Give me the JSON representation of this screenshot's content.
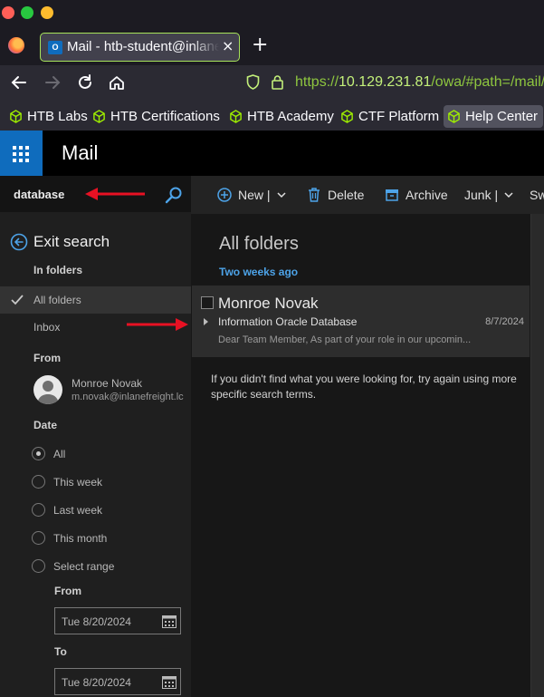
{
  "browser": {
    "tab_title": "Mail - htb-student@inlanefreight.local",
    "tab_close": "×",
    "new_tab": "+",
    "url_scheme": "https://",
    "url_host": "10.129.231.81",
    "url_path": "/owa/#path=/mail/s",
    "bookmarks": [
      "HTB Labs",
      "HTB Certifications",
      "HTB Academy",
      "CTF Platform",
      "Help Center"
    ]
  },
  "owa": {
    "app_title": "Mail",
    "search": {
      "query": "database"
    },
    "exit_search": "Exit search",
    "in_folders_heading": "In folders",
    "folders": [
      "All folders",
      "Inbox"
    ],
    "from_heading": "From",
    "from_person": {
      "name": "Monroe Novak",
      "email": "m.novak@inlanefreight.lc"
    },
    "date_heading": "Date",
    "date_options": [
      "All",
      "This week",
      "Last week",
      "This month",
      "Select range"
    ],
    "date_selected": "All",
    "range_from_label": "From",
    "range_from_value": "Tue 8/20/2024",
    "range_to_label": "To",
    "range_to_value": "Tue 8/20/2024"
  },
  "toolbar": {
    "new_label": "New |",
    "delete_label": "Delete",
    "archive_label": "Archive",
    "junk_label": "Junk |",
    "sweep_label": "Sw"
  },
  "list": {
    "title": "All folders",
    "group_header": "Two weeks ago",
    "message": {
      "from": "Monroe Novak",
      "subject": "Information Oracle Database",
      "date": "8/7/2024",
      "preview": "Dear Team Member,  As part of your role in our upcomin..."
    },
    "hint": "If you didn't find what you were looking for, try again using more specific search terms."
  },
  "colors": {
    "accent": "#0f6cbd",
    "link_blue": "#4da3e8",
    "url_green": "#8ec63f",
    "annotation_red": "#e81123",
    "htb_green": "#9fef00"
  }
}
